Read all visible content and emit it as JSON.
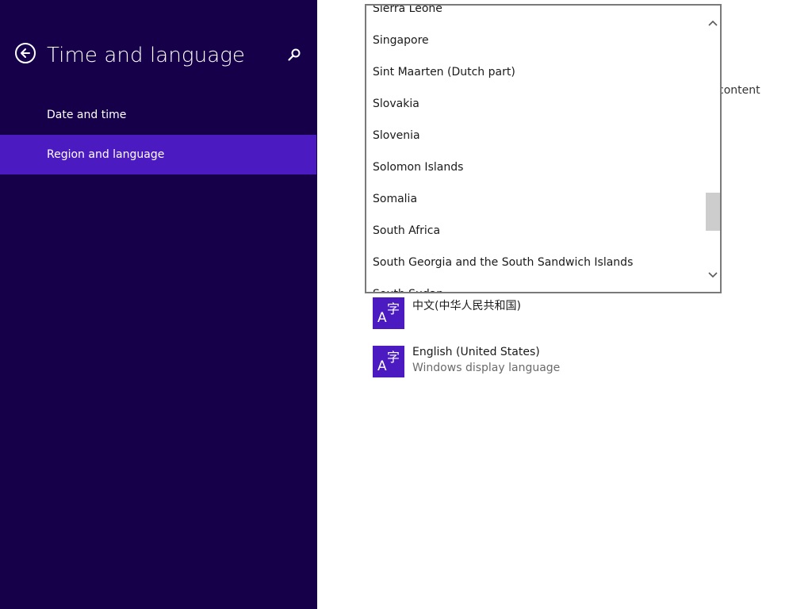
{
  "sidebar": {
    "title": "Time and language",
    "items": [
      {
        "label": "Date and time"
      },
      {
        "label": "Region and language"
      }
    ]
  },
  "main": {
    "partial_text": "content",
    "languages": [
      {
        "name": "中文(中华人民共和国)",
        "subtitle": ""
      },
      {
        "name": "English (United States)",
        "subtitle": "Windows display language"
      }
    ],
    "tile_glyph_a": "A",
    "tile_glyph_zi": "字"
  },
  "country_dropdown": {
    "options": [
      "Sierra Leone",
      "Singapore",
      "Sint Maarten (Dutch part)",
      "Slovakia",
      "Slovenia",
      "Solomon Islands",
      "Somalia",
      "South Africa",
      "South Georgia and the South Sandwich Islands",
      "South Sudan"
    ]
  },
  "colors": {
    "sidebar_bg": "#16004a",
    "accent": "#4b1ac0"
  },
  "icons": {
    "back": "back-arrow-icon",
    "search": "search-icon",
    "scroll_up": "chevron-up-icon",
    "scroll_down": "chevron-down-icon",
    "language": "language-icon"
  }
}
